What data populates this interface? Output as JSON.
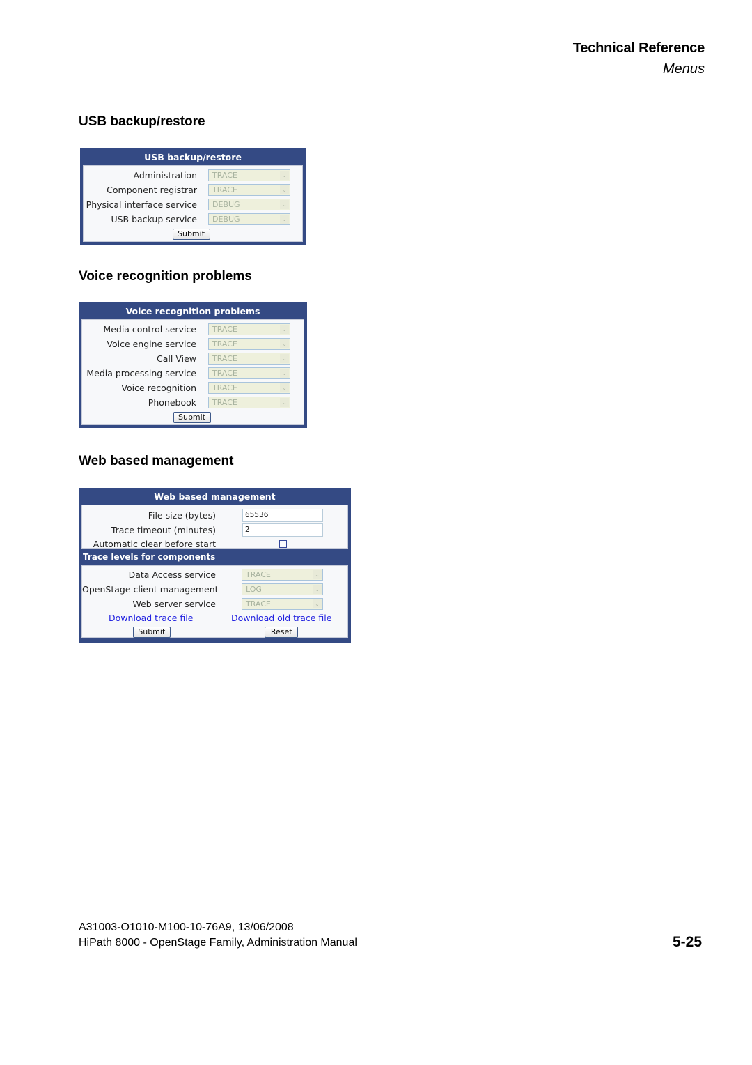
{
  "header": {
    "title": "Technical Reference",
    "subtitle": "Menus"
  },
  "sections": {
    "usb": {
      "heading": "USB backup/restore",
      "panel_title": "USB backup/restore",
      "rows": [
        {
          "label": "Administration",
          "value": "TRACE"
        },
        {
          "label": "Component registrar",
          "value": "TRACE"
        },
        {
          "label": "Physical interface service",
          "value": "DEBUG"
        },
        {
          "label": "USB backup service",
          "value": "DEBUG"
        }
      ],
      "submit_label": "Submit"
    },
    "voice": {
      "heading": "Voice recognition problems",
      "panel_title": "Voice recognition problems",
      "rows": [
        {
          "label": "Media control service",
          "value": "TRACE"
        },
        {
          "label": "Voice engine service",
          "value": "TRACE"
        },
        {
          "label": "Call View",
          "value": "TRACE"
        },
        {
          "label": "Media processing service",
          "value": "TRACE"
        },
        {
          "label": "Voice recognition",
          "value": "TRACE"
        },
        {
          "label": "Phonebook",
          "value": "TRACE"
        }
      ],
      "submit_label": "Submit"
    },
    "web": {
      "heading": "Web based management",
      "panel_title": "Web based management",
      "file_size_label": "File size (bytes)",
      "file_size_value": "65536",
      "trace_timeout_label": "Trace timeout (minutes)",
      "trace_timeout_value": "2",
      "auto_clear_label": "Automatic clear before start",
      "auto_clear_checked": false,
      "subpanel_title": "Trace levels for components",
      "rows": [
        {
          "label": "Data Access service",
          "value": "TRACE"
        },
        {
          "label": "OpenStage client management",
          "value": "LOG"
        },
        {
          "label": "Web server service",
          "value": "TRACE"
        }
      ],
      "download_link": "Download trace file",
      "download_old_link": "Download old trace file",
      "submit_label": "Submit",
      "reset_label": "Reset"
    }
  },
  "footer": {
    "doc_id": "A31003-O1010-M100-10-76A9, 13/06/2008",
    "manual_title": "HiPath 8000 - OpenStage Family, Administration Manual",
    "page_number": "5-25"
  },
  "colors": {
    "panel_header": "#344a84",
    "select_bg": "#eef0dc",
    "link": "#2323e0"
  }
}
